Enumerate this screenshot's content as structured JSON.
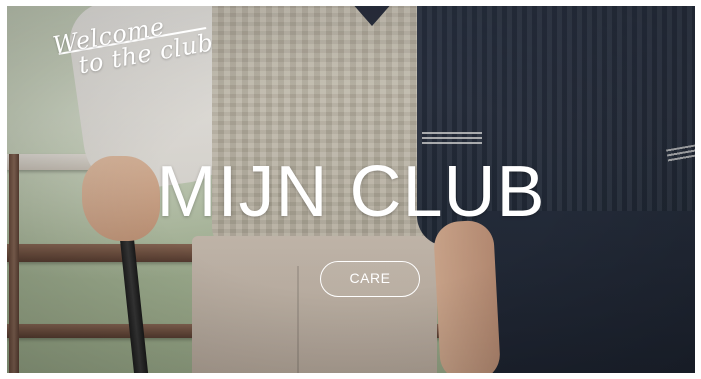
{
  "hero": {
    "script_line1": "Welcome",
    "script_line2": "to the club",
    "title": "MIJN CLUB",
    "button_label": "CARE"
  },
  "colors": {
    "overlay_text": "#ffffff",
    "button_border": "#ffffff"
  }
}
